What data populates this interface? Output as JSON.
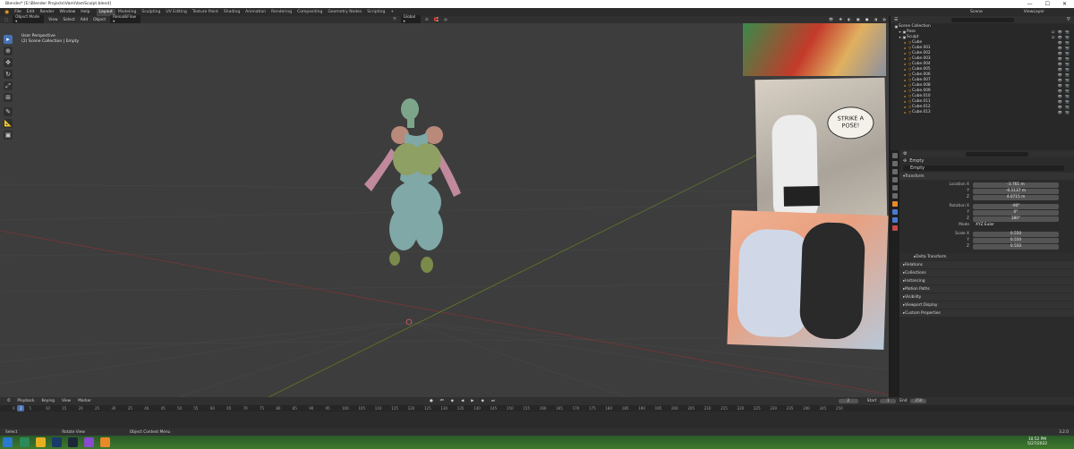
{
  "window": {
    "title": "Blender* [E:\\Blender Projects\\Vam\\VamSculpt.blend]",
    "controls": [
      "—",
      "☐",
      "✕"
    ]
  },
  "menubar": {
    "menus": [
      "File",
      "Edit",
      "Render",
      "Window",
      "Help"
    ],
    "workspaces": [
      "Layout",
      "Modeling",
      "Sculpting",
      "UV Editing",
      "Texture Paint",
      "Shading",
      "Animation",
      "Rendering",
      "Compositing",
      "Geometry Nodes",
      "Scripting"
    ],
    "active_workspace": "Layout",
    "add_tab": "+",
    "scene": "Scene",
    "view_layer": "ViewLayer"
  },
  "viewport_header": {
    "mode": "Object Mode",
    "menus": [
      "View",
      "Select",
      "Add",
      "Object"
    ],
    "collection": "ReinaBiFlow",
    "orientation": "Global",
    "options": "Options"
  },
  "viewport": {
    "info_line1": "User Perspective",
    "info_line2": "(2) Scene Collection | Empty",
    "colors": {
      "bg": "#3d3d3d",
      "grid": "#484848",
      "x_axis": "#8b3a3a",
      "y_axis": "#6b8a2a"
    }
  },
  "reference_text": "STRIKE A POSE!",
  "outliner": {
    "search_placeholder": "",
    "scene_collection": "Scene Collection",
    "items": [
      {
        "label": "Pose",
        "indent": 1
      },
      {
        "label": "Sculpt",
        "indent": 1
      },
      {
        "label": "Cube",
        "indent": 2
      },
      {
        "label": "Cube.001",
        "indent": 2
      },
      {
        "label": "Cube.002",
        "indent": 2
      },
      {
        "label": "Cube.003",
        "indent": 2
      },
      {
        "label": "Cube.004",
        "indent": 2
      },
      {
        "label": "Cube.005",
        "indent": 2
      },
      {
        "label": "Cube.006",
        "indent": 2
      },
      {
        "label": "Cube.007",
        "indent": 2
      },
      {
        "label": "Cube.008",
        "indent": 2
      },
      {
        "label": "Cube.009",
        "indent": 2
      },
      {
        "label": "Cube.010",
        "indent": 2
      },
      {
        "label": "Cube.011",
        "indent": 2
      },
      {
        "label": "Cube.012",
        "indent": 2
      },
      {
        "label": "Cube.013",
        "indent": 2
      }
    ]
  },
  "properties": {
    "object_name_header": "Empty",
    "object_name": "Empty",
    "transform_label": "Transform",
    "location_label": "Location X",
    "location": [
      "-3.761 m",
      "-0.1137 m",
      "4.0715 m"
    ],
    "rotation_label": "Rotation X",
    "rotation": [
      "-90°",
      "0°",
      "180°"
    ],
    "mode_label": "Mode",
    "mode_value": "XYZ Euler",
    "scale_label": "Scale X",
    "scale": [
      "0.550",
      "0.550",
      "0.550"
    ],
    "y_label": "Y",
    "z_label": "Z",
    "panels": [
      "Delta Transform",
      "Relations",
      "Collections",
      "Instancing",
      "Motion Paths",
      "Visibility",
      "Viewport Display",
      "Custom Properties"
    ]
  },
  "timeline": {
    "menus": [
      "Playback",
      "Keying",
      "View",
      "Marker"
    ],
    "current_frame": "2",
    "start_label": "Start",
    "start": "1",
    "end_label": "End",
    "end": "250",
    "ticks": [
      "0",
      "5",
      "10",
      "15",
      "20",
      "25",
      "30",
      "35",
      "40",
      "45",
      "50",
      "55",
      "60",
      "65",
      "70",
      "75",
      "80",
      "85",
      "90",
      "95",
      "100",
      "105",
      "110",
      "115",
      "120",
      "125",
      "130",
      "135",
      "140",
      "145",
      "150",
      "155",
      "160",
      "165",
      "170",
      "175",
      "180",
      "185",
      "190",
      "195",
      "200",
      "205",
      "210",
      "215",
      "220",
      "225",
      "230",
      "235",
      "240",
      "245",
      "250"
    ]
  },
  "statusbar": {
    "select": "Select",
    "rotate": "Rotate View",
    "context": "Object Context Menu",
    "version": "3.2.0"
  },
  "taskbar": {
    "time": "10:52 PM",
    "date": "5/27/2022"
  }
}
